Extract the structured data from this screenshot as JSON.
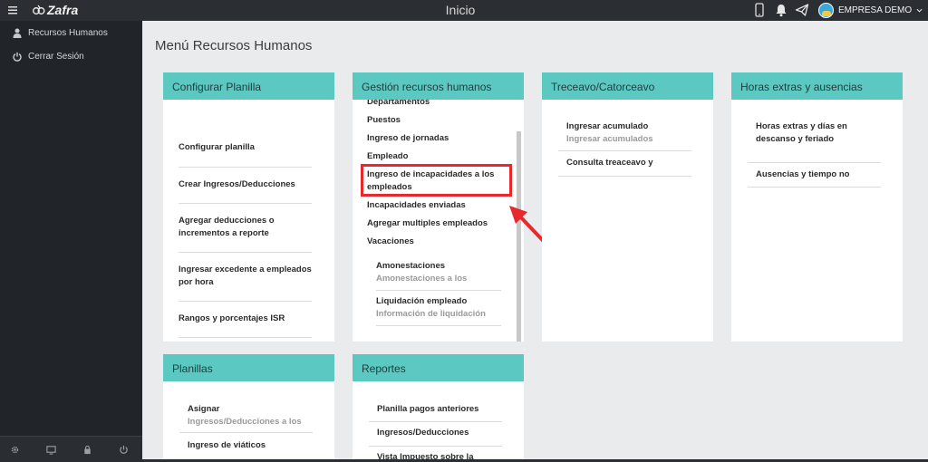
{
  "app": {
    "brand": "Zafra",
    "window_title": "Inicio"
  },
  "topbar": {
    "company": "EMPRESA DEMO"
  },
  "sidebar": {
    "items": [
      {
        "label": "Recursos Humanos",
        "icon": "user-icon"
      },
      {
        "label": "Cerrar Sesión",
        "icon": "power-icon"
      }
    ],
    "footer_icons": [
      "settings-icon",
      "monitor-icon",
      "lock-icon",
      "power-icon"
    ]
  },
  "main": {
    "title": "Menú Recursos Humanos",
    "cards": {
      "configurar": {
        "title": "Configurar Planilla",
        "items": [
          "Configurar planilla",
          "Crear Ingresos/Deducciones",
          "Agregar deducciones o incrementos a reporte",
          "Ingresar excedente a empleados por hora",
          "Rangos y porcentajes ISR"
        ]
      },
      "gestion": {
        "title": "Gestión recursos humanos",
        "items": [
          "Departamentos",
          "Puestos",
          "Ingreso de jornadas",
          "Empleado",
          "Ingreso de incapacidades a los empleados",
          "Incapacidades enviadas",
          "Agregar multiples empleados",
          "Vacaciones"
        ],
        "sub_items": [
          {
            "title": "Amonestaciones",
            "subtitle": "Amonestaciones a los"
          },
          {
            "title": "Liquidación empleado",
            "subtitle": "Información de liquidación"
          }
        ]
      },
      "treceavo": {
        "title": "Treceavo/Catorceavo",
        "items": [
          {
            "title": "Ingresar acumulado",
            "subtitle": "Ingresar acumulados"
          },
          {
            "title": "Consulta treaceavo y",
            "subtitle": ""
          }
        ]
      },
      "horas": {
        "title": "Horas extras y ausencias",
        "items": [
          {
            "title": "Horas extras y días en descanso y feriado"
          },
          {
            "title": "Ausencias y tiempo no"
          }
        ]
      },
      "planillas": {
        "title": "Planillas",
        "items": [
          {
            "title": "Asignar",
            "subtitle": "Ingresos/Deducciones a los"
          },
          {
            "title": "Ingreso de viáticos",
            "subtitle": ""
          }
        ]
      },
      "reportes": {
        "title": "Reportes",
        "items": [
          "Planilla pagos anteriores",
          "Ingresos/Deducciones",
          "Vista Impuesto sobre la"
        ]
      }
    }
  },
  "colors": {
    "card_header": "#5cc8c2",
    "highlight": "#e8282c",
    "sidebar": "#212529",
    "topbar": "#2b2f33"
  }
}
